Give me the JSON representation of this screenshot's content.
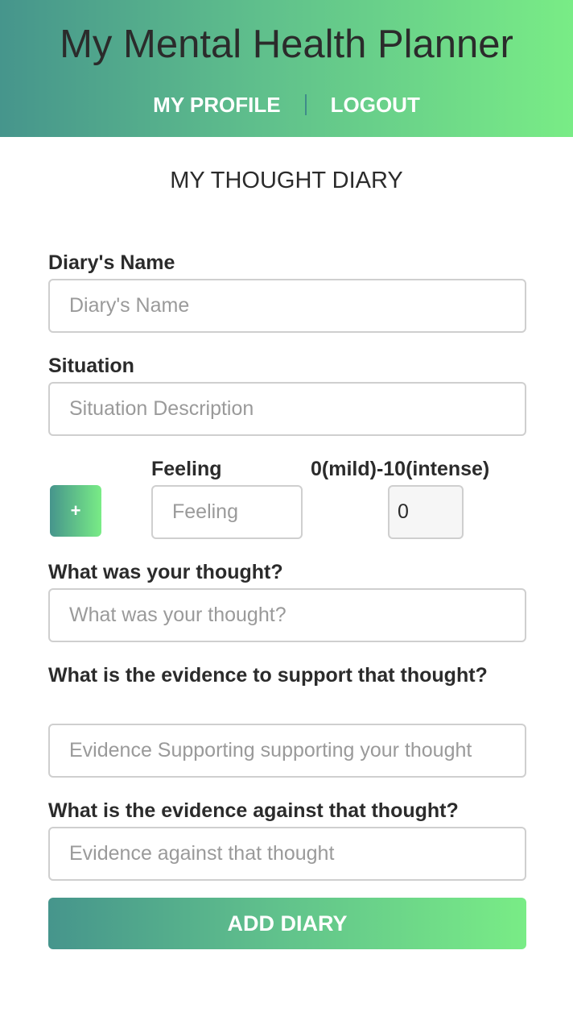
{
  "header": {
    "title": "My Mental Health Planner",
    "nav": {
      "profile_label": "MY PROFILE",
      "logout_label": "LOGOUT"
    }
  },
  "page": {
    "title": "MY THOUGHT DIARY"
  },
  "form": {
    "diary_name": {
      "label": "Diary's Name",
      "placeholder": "Diary's Name",
      "value": ""
    },
    "situation": {
      "label": "Situation",
      "placeholder": "Situation Description",
      "value": ""
    },
    "feeling": {
      "add_button_label": "+",
      "label": "Feeling",
      "placeholder": "Feeling",
      "value": "",
      "intensity_label": "0(mild)-10(intense)",
      "intensity_value": "0"
    },
    "thought": {
      "label": "What was your thought?",
      "placeholder": "What was your thought?",
      "value": ""
    },
    "evidence_for": {
      "label": "What is the evidence to support that thought?",
      "placeholder": "Evidence Supporting supporting your thought",
      "value": ""
    },
    "evidence_against": {
      "label": "What is the evidence against that thought?",
      "placeholder": "Evidence against that thought",
      "value": ""
    },
    "submit_label": "ADD DIARY"
  },
  "colors": {
    "gradient_start": "#46958c",
    "gradient_end": "#79ec86",
    "nav_separator": "#3f8c8a",
    "text_dark": "#2b2b2b",
    "placeholder": "#9a9a9a",
    "field_border": "#cfcfcf"
  }
}
